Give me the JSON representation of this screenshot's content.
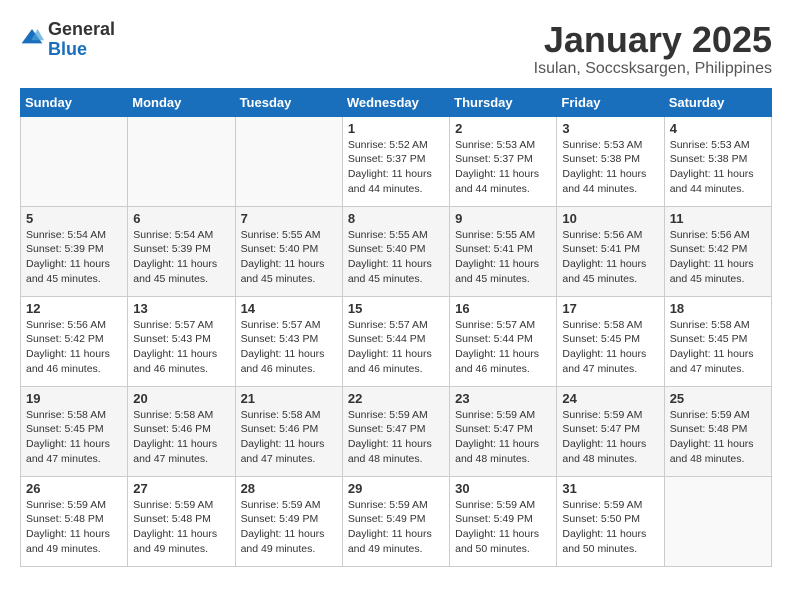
{
  "logo": {
    "general": "General",
    "blue": "Blue"
  },
  "title": "January 2025",
  "subtitle": "Isulan, Soccsksargen, Philippines",
  "headers": [
    "Sunday",
    "Monday",
    "Tuesday",
    "Wednesday",
    "Thursday",
    "Friday",
    "Saturday"
  ],
  "weeks": [
    [
      {
        "day": "",
        "info": ""
      },
      {
        "day": "",
        "info": ""
      },
      {
        "day": "",
        "info": ""
      },
      {
        "day": "1",
        "info": "Sunrise: 5:52 AM\nSunset: 5:37 PM\nDaylight: 11 hours and 44 minutes."
      },
      {
        "day": "2",
        "info": "Sunrise: 5:53 AM\nSunset: 5:37 PM\nDaylight: 11 hours and 44 minutes."
      },
      {
        "day": "3",
        "info": "Sunrise: 5:53 AM\nSunset: 5:38 PM\nDaylight: 11 hours and 44 minutes."
      },
      {
        "day": "4",
        "info": "Sunrise: 5:53 AM\nSunset: 5:38 PM\nDaylight: 11 hours and 44 minutes."
      }
    ],
    [
      {
        "day": "5",
        "info": "Sunrise: 5:54 AM\nSunset: 5:39 PM\nDaylight: 11 hours and 45 minutes."
      },
      {
        "day": "6",
        "info": "Sunrise: 5:54 AM\nSunset: 5:39 PM\nDaylight: 11 hours and 45 minutes."
      },
      {
        "day": "7",
        "info": "Sunrise: 5:55 AM\nSunset: 5:40 PM\nDaylight: 11 hours and 45 minutes."
      },
      {
        "day": "8",
        "info": "Sunrise: 5:55 AM\nSunset: 5:40 PM\nDaylight: 11 hours and 45 minutes."
      },
      {
        "day": "9",
        "info": "Sunrise: 5:55 AM\nSunset: 5:41 PM\nDaylight: 11 hours and 45 minutes."
      },
      {
        "day": "10",
        "info": "Sunrise: 5:56 AM\nSunset: 5:41 PM\nDaylight: 11 hours and 45 minutes."
      },
      {
        "day": "11",
        "info": "Sunrise: 5:56 AM\nSunset: 5:42 PM\nDaylight: 11 hours and 45 minutes."
      }
    ],
    [
      {
        "day": "12",
        "info": "Sunrise: 5:56 AM\nSunset: 5:42 PM\nDaylight: 11 hours and 46 minutes."
      },
      {
        "day": "13",
        "info": "Sunrise: 5:57 AM\nSunset: 5:43 PM\nDaylight: 11 hours and 46 minutes."
      },
      {
        "day": "14",
        "info": "Sunrise: 5:57 AM\nSunset: 5:43 PM\nDaylight: 11 hours and 46 minutes."
      },
      {
        "day": "15",
        "info": "Sunrise: 5:57 AM\nSunset: 5:44 PM\nDaylight: 11 hours and 46 minutes."
      },
      {
        "day": "16",
        "info": "Sunrise: 5:57 AM\nSunset: 5:44 PM\nDaylight: 11 hours and 46 minutes."
      },
      {
        "day": "17",
        "info": "Sunrise: 5:58 AM\nSunset: 5:45 PM\nDaylight: 11 hours and 47 minutes."
      },
      {
        "day": "18",
        "info": "Sunrise: 5:58 AM\nSunset: 5:45 PM\nDaylight: 11 hours and 47 minutes."
      }
    ],
    [
      {
        "day": "19",
        "info": "Sunrise: 5:58 AM\nSunset: 5:45 PM\nDaylight: 11 hours and 47 minutes."
      },
      {
        "day": "20",
        "info": "Sunrise: 5:58 AM\nSunset: 5:46 PM\nDaylight: 11 hours and 47 minutes."
      },
      {
        "day": "21",
        "info": "Sunrise: 5:58 AM\nSunset: 5:46 PM\nDaylight: 11 hours and 47 minutes."
      },
      {
        "day": "22",
        "info": "Sunrise: 5:59 AM\nSunset: 5:47 PM\nDaylight: 11 hours and 48 minutes."
      },
      {
        "day": "23",
        "info": "Sunrise: 5:59 AM\nSunset: 5:47 PM\nDaylight: 11 hours and 48 minutes."
      },
      {
        "day": "24",
        "info": "Sunrise: 5:59 AM\nSunset: 5:47 PM\nDaylight: 11 hours and 48 minutes."
      },
      {
        "day": "25",
        "info": "Sunrise: 5:59 AM\nSunset: 5:48 PM\nDaylight: 11 hours and 48 minutes."
      }
    ],
    [
      {
        "day": "26",
        "info": "Sunrise: 5:59 AM\nSunset: 5:48 PM\nDaylight: 11 hours and 49 minutes."
      },
      {
        "day": "27",
        "info": "Sunrise: 5:59 AM\nSunset: 5:48 PM\nDaylight: 11 hours and 49 minutes."
      },
      {
        "day": "28",
        "info": "Sunrise: 5:59 AM\nSunset: 5:49 PM\nDaylight: 11 hours and 49 minutes."
      },
      {
        "day": "29",
        "info": "Sunrise: 5:59 AM\nSunset: 5:49 PM\nDaylight: 11 hours and 49 minutes."
      },
      {
        "day": "30",
        "info": "Sunrise: 5:59 AM\nSunset: 5:49 PM\nDaylight: 11 hours and 50 minutes."
      },
      {
        "day": "31",
        "info": "Sunrise: 5:59 AM\nSunset: 5:50 PM\nDaylight: 11 hours and 50 minutes."
      },
      {
        "day": "",
        "info": ""
      }
    ]
  ]
}
